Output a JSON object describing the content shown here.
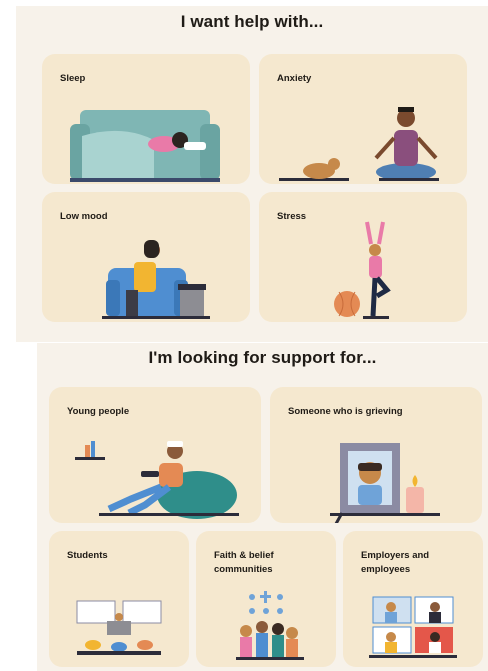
{
  "help_section": {
    "heading": "I want help with...",
    "cards": [
      {
        "label": "Sleep",
        "illustration": "person-sleeping-on-sofa"
      },
      {
        "label": "Anxiety",
        "illustration": "meditating-person-with-dog"
      },
      {
        "label": "Low mood",
        "illustration": "person-sitting-in-armchair"
      },
      {
        "label": "Stress",
        "illustration": "yoga-pose-with-ball"
      }
    ]
  },
  "support_section": {
    "heading": "I'm looking for support for...",
    "cards": [
      {
        "label": "Young people",
        "illustration": "teen-on-beanbag-with-phone"
      },
      {
        "label": "Someone who is grieving",
        "illustration": "framed-portrait-with-candle"
      },
      {
        "label": "Students",
        "illustration": "classroom-desks"
      },
      {
        "label": "Faith & belief communities",
        "illustration": "group-with-faith-symbols"
      },
      {
        "label": "Employers and employees",
        "illustration": "video-call-grid"
      }
    ]
  },
  "colors": {
    "panel_background": "#f7f2ea",
    "card_background": "#f5e8cf",
    "heading_text": "#1f1b16"
  }
}
